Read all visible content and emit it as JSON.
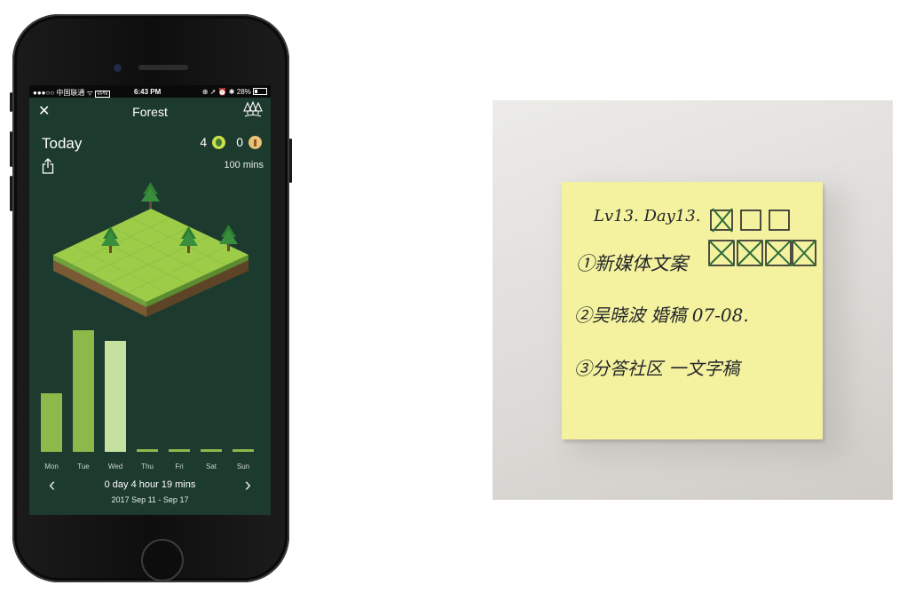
{
  "phone": {
    "status_bar": {
      "carrier": "●●●○○ 中国联通",
      "wifi": "ᯤ",
      "vpn": "VPN",
      "time": "6:43 PM",
      "indicators": "⊕ ➚ ⏰ ✱",
      "battery": "28%"
    },
    "nav": {
      "close_icon": "close-icon",
      "title": "Forest",
      "forest_icon": "forest-trees-icon"
    },
    "header": {
      "period_label": "Today",
      "tree_count": "4",
      "dead_count": "0",
      "total_time": "100 mins",
      "share_icon": "share-icon"
    },
    "chart_data": {
      "type": "bar",
      "categories": [
        "Mon",
        "Tue",
        "Wed",
        "Thu",
        "Fri",
        "Sat",
        "Sun"
      ],
      "values": [
        66,
        137,
        125,
        2,
        2,
        2,
        2
      ],
      "ylim": [
        0,
        140
      ],
      "title": "",
      "xlabel": "",
      "ylabel": "",
      "grid": false,
      "colors": [
        "#8db84a",
        "#8db84a",
        "#c6e0a0",
        "#8db84a",
        "#8db84a",
        "#8db84a",
        "#8db84a"
      ]
    },
    "footer": {
      "summary": "0 day 4 hour 19 mins",
      "date_range": "2017 Sep 11 - Sep 17",
      "prev_icon": "chevron-left-icon",
      "next_icon": "chevron-right-icon"
    },
    "colors": {
      "background": "#1d3a2e",
      "bar": "#8db84a",
      "bar_highlight": "#c6e0a0"
    }
  },
  "sticky_note": {
    "line_header": "Lv13. Day13.",
    "line_1": "①新媒体文案",
    "line_2": "②吴晓波 婚稿 07-08.",
    "line_3": "③分答社区 一文字稿",
    "colors": {
      "paper": "#f4f29f",
      "ink": "#23262a",
      "check": "#2f6b3a"
    }
  }
}
